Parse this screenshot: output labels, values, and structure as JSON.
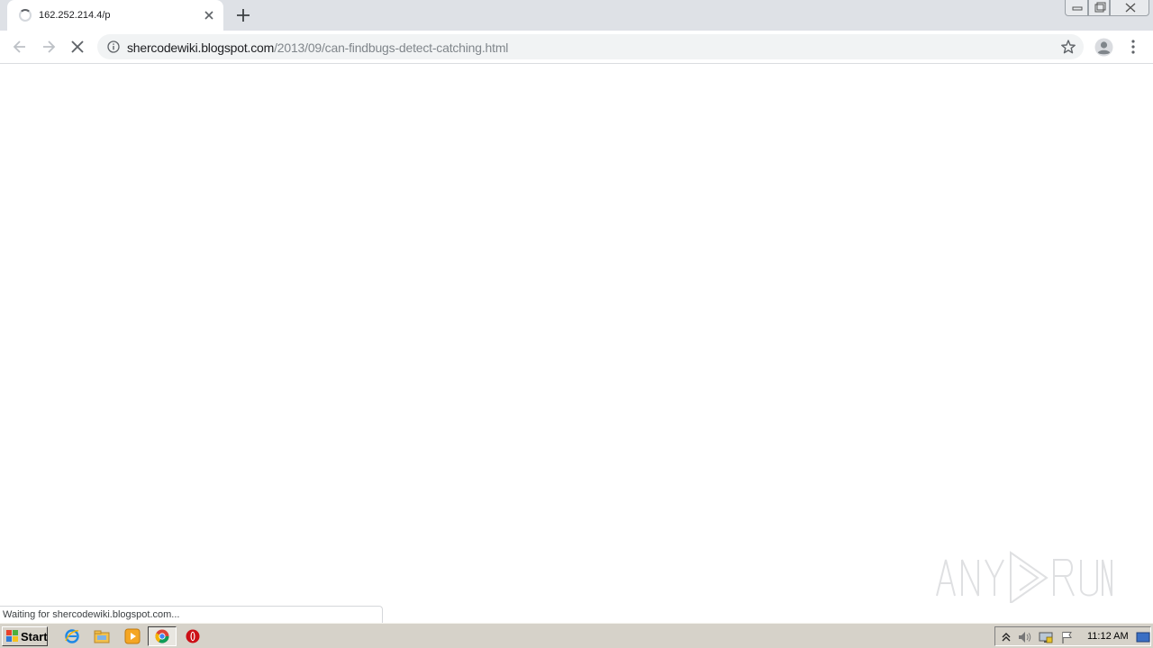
{
  "browser": {
    "tab": {
      "title": "162.252.214.4/p",
      "loading": true
    },
    "address_bar": {
      "host": "shercodewiki.blogspot.com",
      "path": "/2013/09/can-findbugs-detect-catching.html"
    },
    "status_text": "Waiting for shercodewiki.blogspot.com...",
    "icons": [
      "back-icon",
      "forward-icon",
      "stop-icon",
      "info-icon",
      "star-icon",
      "avatar-icon",
      "menu-icon",
      "new-tab-icon",
      "close-icon"
    ]
  },
  "taskbar": {
    "start_label": "Start",
    "clock": "11:12 AM",
    "apps": [
      "ie-icon",
      "explorer-icon",
      "media-player-icon",
      "chrome-icon",
      "opera-icon"
    ]
  },
  "colors": {
    "tabstrip": "#dee1e6",
    "omnibox": "#f1f3f4",
    "taskbar": "#d6d2c9"
  }
}
